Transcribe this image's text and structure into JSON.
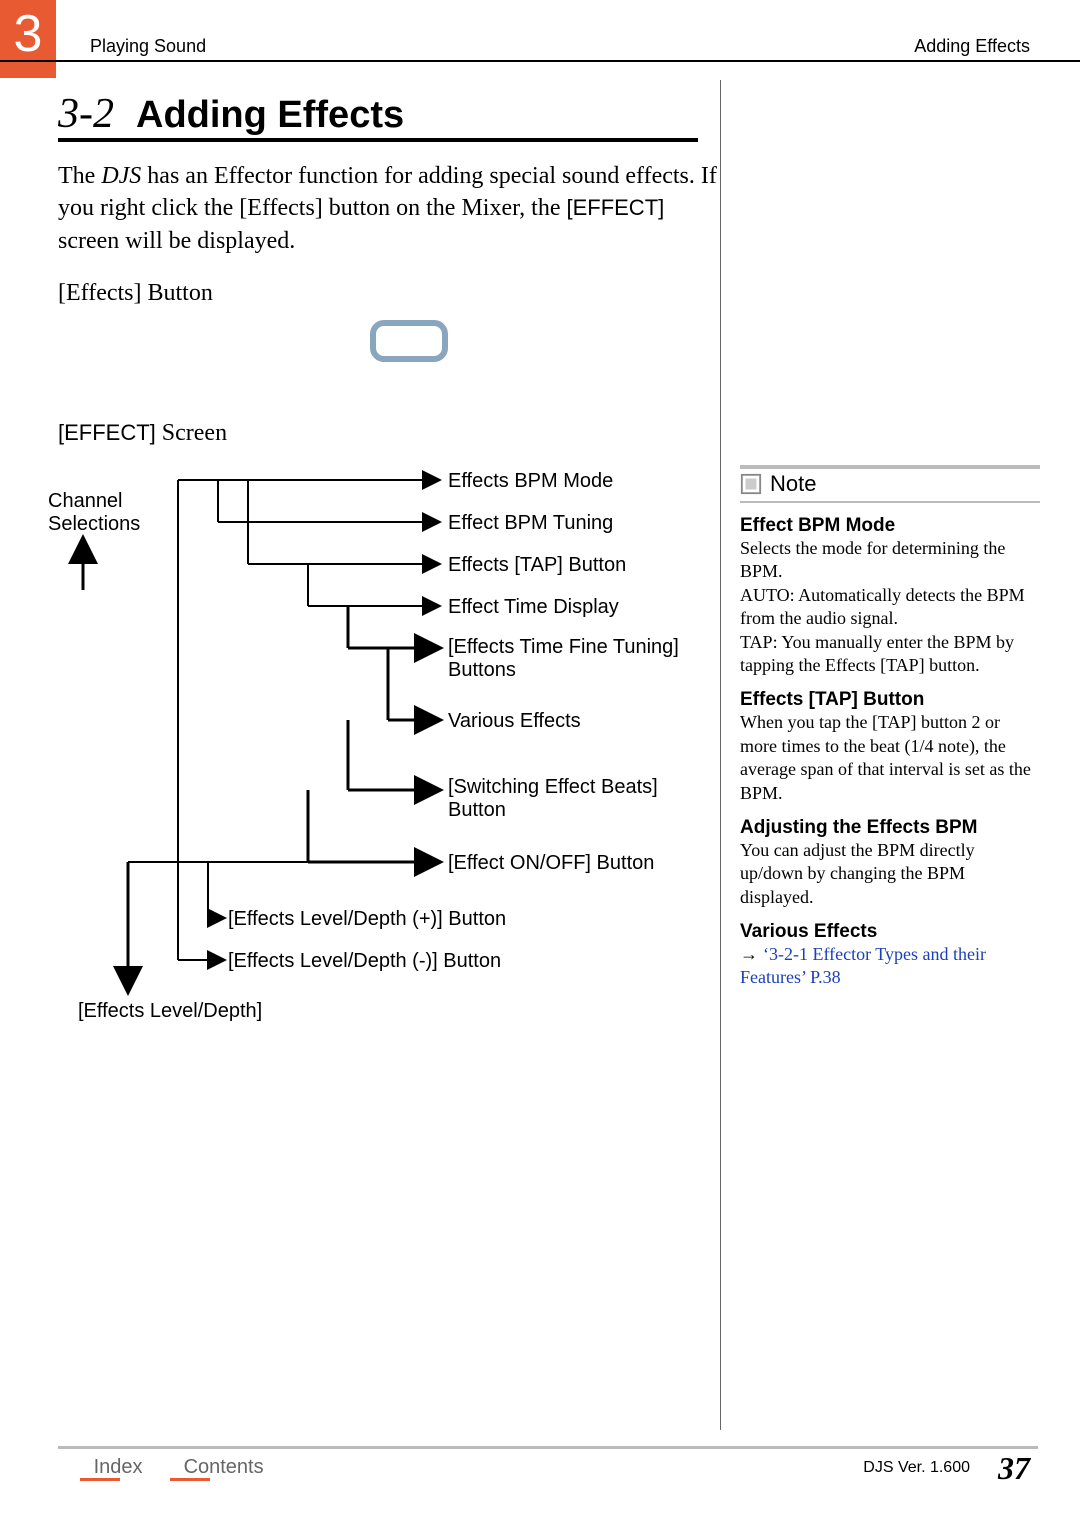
{
  "chapter": {
    "number": "3",
    "header_left": "Playing Sound",
    "header_right": "Adding Effects"
  },
  "section": {
    "number": "3-2",
    "title": "Adding Effects"
  },
  "body": {
    "p1a": "The ",
    "p1_djs": "DJS",
    "p1b": " has an Effector function for adding special sound effects. If you right click the [Effects] button on the Mixer, the ",
    "p1_effect": "[EFFECT]",
    "p1c": " screen will be displayed.",
    "effects_button_label": "[Effects] Button",
    "effect_screen_label_sans": "[EFFECT]",
    "effect_screen_label_serif": " Screen"
  },
  "diagram": {
    "channel_selections": "Channel Selections",
    "d1": "Effects BPM Mode",
    "d2": "Effect BPM Tuning",
    "d3": "Effects [TAP] Button",
    "d4": "Effect Time Display",
    "d5": "[Effects Time Fine Tuning] Buttons",
    "d6": "Various Effects",
    "d7": "[Switching Effect Beats] Button",
    "d8": "[Effect ON/OFF] Button",
    "d9": "[Effects Level/Depth (+)] Button",
    "d10": "[Effects Level/Depth (-)] Button",
    "d11": "[Effects Level/Depth]"
  },
  "note": {
    "header": "Note",
    "h1": "Effect BPM Mode",
    "p1": "Selects the mode for determining the BPM.",
    "p1b": "AUTO: Automatically detects the BPM from the audio signal.",
    "p1c": "TAP: You manually enter the BPM by tapping the Effects [TAP] button.",
    "h2": "Effects [TAP] Button",
    "p2": "When you tap the [TAP] button 2 or more times to the beat (1/4 note), the average span of that interval is set as the BPM.",
    "h3": "Adjusting the Effects BPM",
    "p3": "You can adjust the BPM directly up/down by changing the BPM displayed.",
    "h4": "Various Effects",
    "link_arrow": "→ ",
    "link_text": "‘3-2-1 Effector Types and their Features’ P.38"
  },
  "footer": {
    "index": "Index",
    "contents": "Contents",
    "version": "DJS Ver. 1.600",
    "page": "37"
  }
}
